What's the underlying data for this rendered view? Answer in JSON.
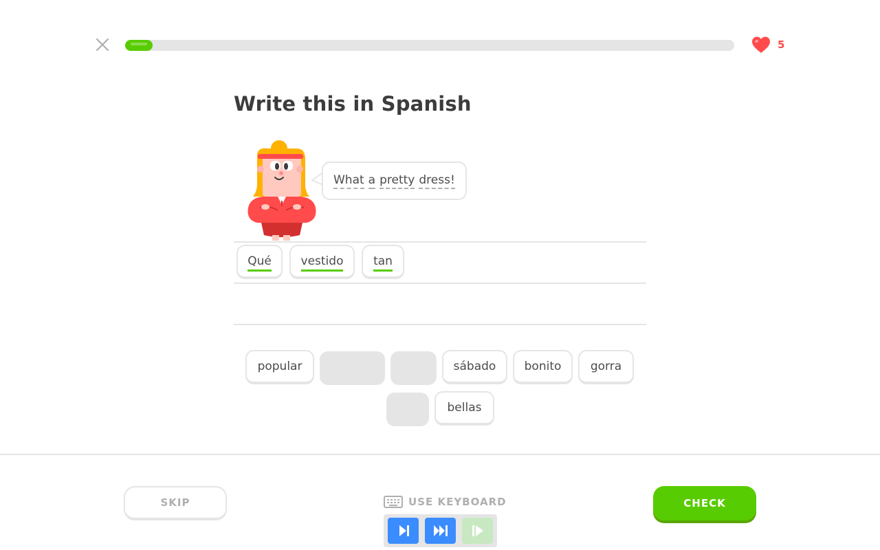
{
  "header": {
    "close_icon": "close-icon",
    "progress": 0.045,
    "hearts": {
      "icon": "heart-icon",
      "count": "5",
      "color": "#ff4b4b"
    }
  },
  "challenge": {
    "title": "Write this in Spanish",
    "prompt_words": [
      "What",
      "a",
      "pretty",
      "dress!"
    ]
  },
  "answer": {
    "tiles": [
      "Qué",
      "vestido",
      "tan"
    ]
  },
  "word_bank": {
    "row1": [
      {
        "label": "popular",
        "used": false
      },
      {
        "label": "",
        "used": true
      },
      {
        "label": "",
        "used": true
      },
      {
        "label": "sábado",
        "used": false
      },
      {
        "label": "bonito",
        "used": false
      },
      {
        "label": "gorra",
        "used": false
      }
    ],
    "row2": [
      {
        "label": "",
        "used": true
      },
      {
        "label": "bellas",
        "used": false
      }
    ]
  },
  "footer": {
    "skip_label": "SKIP",
    "keyboard_label": "USE KEYBOARD",
    "check_label": "CHECK"
  },
  "colors": {
    "accent_green": "#58cc02",
    "hearts_red": "#ff4b4b",
    "media_blue": "#3b8cff",
    "muted_gray": "#afafaf"
  }
}
